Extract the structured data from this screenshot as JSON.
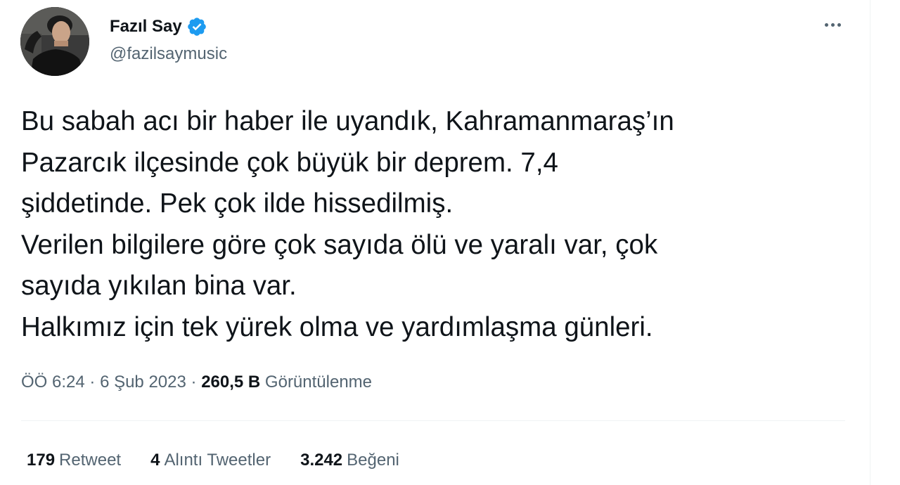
{
  "author": {
    "display_name": "Fazıl Say",
    "handle": "@fazilsaymusic",
    "verified": true,
    "verified_color": "#1d9bf0"
  },
  "more_menu": {
    "icon": "more-horizontal-icon"
  },
  "tweet": {
    "lines": [
      "Bu sabah acı bir haber ile uyandık, Kahramanmaraş’ın",
      "Pazarcık ilçesinde çok büyük bir deprem. 7,4",
      "şiddetinde. Pek çok ilde hissedilmiş.",
      "Verilen bilgilere göre çok sayıda ölü ve yaralı var, çok",
      "sayıda yıkılan bina var.",
      "Halkımız için tek yürek olma ve yardımlaşma günleri."
    ]
  },
  "meta": {
    "time": "ÖÖ 6:24",
    "separator": "·",
    "date": "6 Şub 2023",
    "views_count": "260,5 B",
    "views_label": "Görüntülenme"
  },
  "stats": [
    {
      "count": "179",
      "label": "Retweet"
    },
    {
      "count": "4",
      "label": "Alıntı Tweetler"
    },
    {
      "count": "3.242",
      "label": "Beğeni"
    }
  ],
  "colors": {
    "text_primary": "#0f1419",
    "text_secondary": "#536471",
    "divider": "#eff3f4"
  }
}
